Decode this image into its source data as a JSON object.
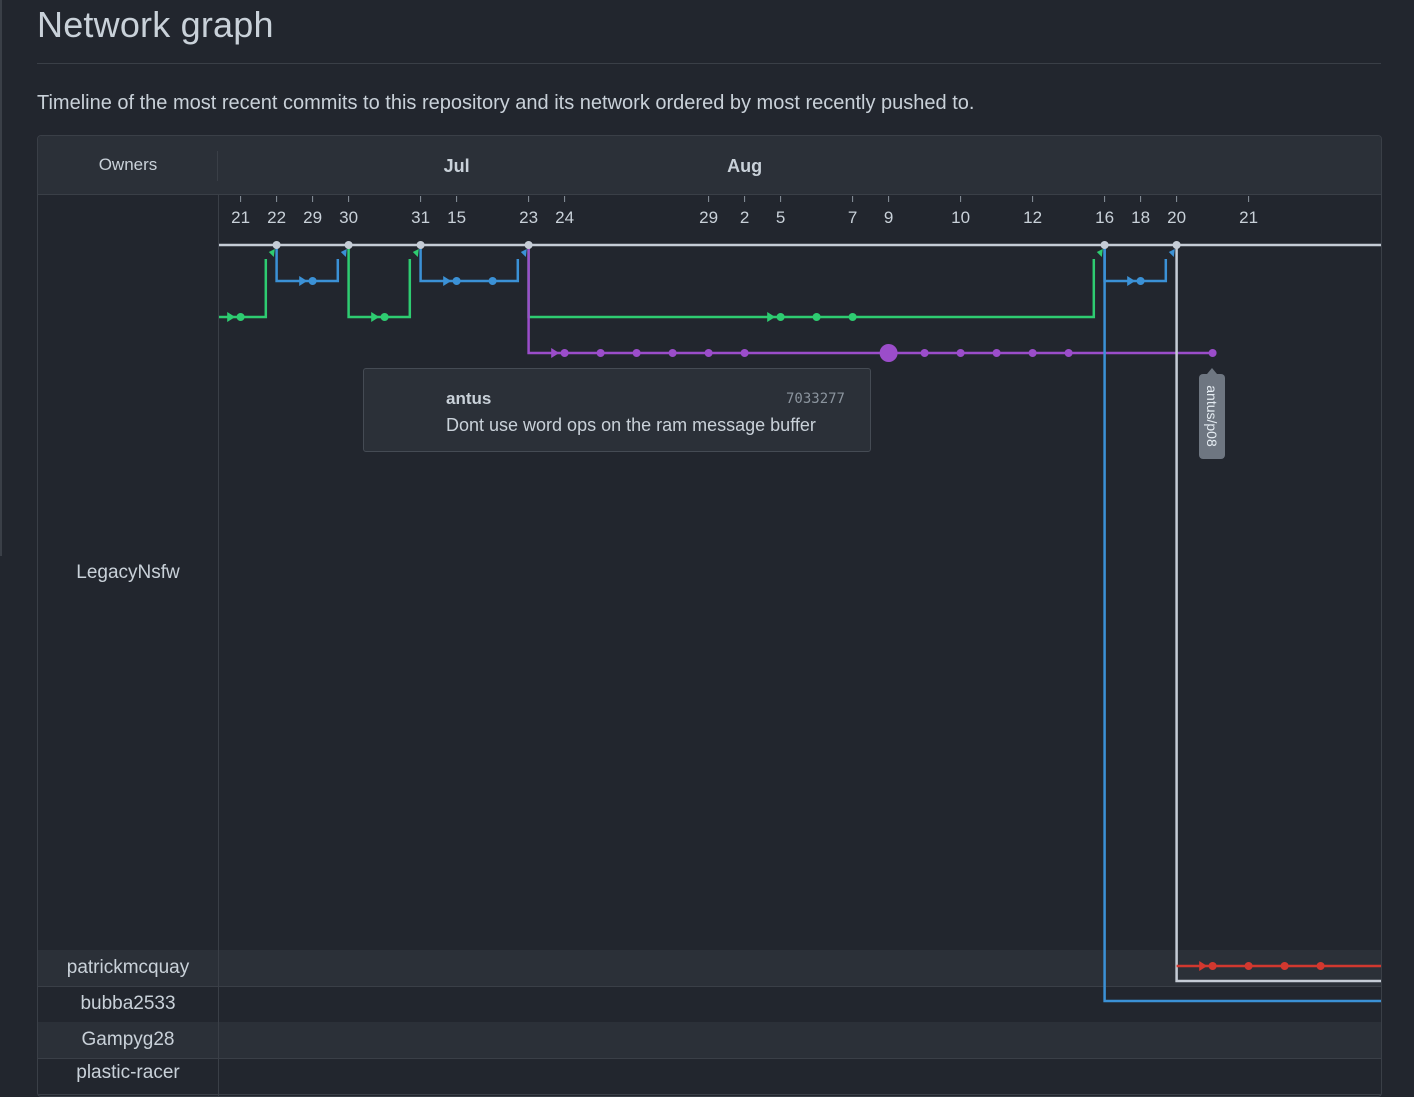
{
  "page": {
    "title": "Network graph",
    "subtitle": "Timeline of the most recent commits to this repository and its network ordered by most recently pushed to."
  },
  "graph": {
    "owners_header": "Owners",
    "months": [
      {
        "label": "Jul",
        "col": 6.6
      },
      {
        "label": "Aug",
        "col": 14.6
      }
    ],
    "days": [
      {
        "label": "21",
        "col": 0.6
      },
      {
        "label": "22",
        "col": 1.6
      },
      {
        "label": "29",
        "col": 2.6
      },
      {
        "label": "30",
        "col": 3.6
      },
      {
        "label": "31",
        "col": 5.6
      },
      {
        "label": "15",
        "col": 6.6
      },
      {
        "label": "23",
        "col": 8.6
      },
      {
        "label": "24",
        "col": 9.6
      },
      {
        "label": "29",
        "col": 13.6
      },
      {
        "label": "2",
        "col": 14.6
      },
      {
        "label": "5",
        "col": 15.6
      },
      {
        "label": "7",
        "col": 17.6
      },
      {
        "label": "9",
        "col": 18.6
      },
      {
        "label": "10",
        "col": 20.6
      },
      {
        "label": "12",
        "col": 22.6
      },
      {
        "label": "16",
        "col": 24.6
      },
      {
        "label": "18",
        "col": 25.6
      },
      {
        "label": "20",
        "col": 26.6
      },
      {
        "label": "21",
        "col": 28.6
      }
    ],
    "owners": [
      {
        "name": "LegacyNsfw"
      },
      {
        "name": "patrickmcquay"
      },
      {
        "name": "bubba2533"
      },
      {
        "name": "Gampyg28"
      },
      {
        "name": "plastic-racer"
      }
    ],
    "colors": {
      "master": "#c5ccd6",
      "blue": "#3b91d6",
      "green": "#2ecc71",
      "purple": "#9b4dca",
      "red": "#d1382f"
    },
    "tooltip": {
      "author": "antus",
      "sha": "7033277",
      "message": "Dont use word ops on the ram message buffer"
    },
    "branch_label": "antus/p08"
  }
}
